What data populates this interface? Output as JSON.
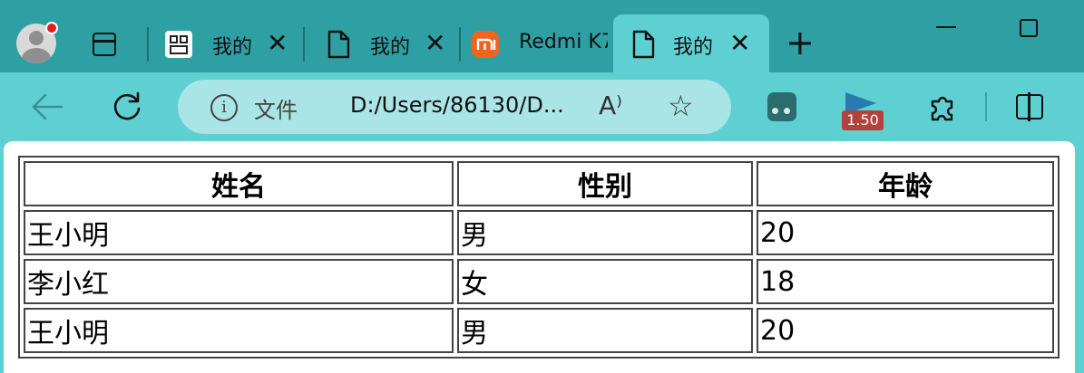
{
  "browser": {
    "tabs": [
      {
        "title": "我的",
        "favicon": "app-grid-icon",
        "active": false
      },
      {
        "title": "我的",
        "favicon": "file-icon",
        "active": false
      },
      {
        "title": "Redmi K7",
        "favicon": "mi-icon",
        "active": false
      },
      {
        "title": "我的",
        "favicon": "file-icon",
        "active": true
      }
    ],
    "close_glyph": "✕",
    "new_tab_glyph": "+",
    "address": {
      "info_glyph": "i",
      "scheme_label": "文件",
      "url": "D:/Users/86130/D...",
      "read_aloud_glyph": "A⁾",
      "favorite_glyph": "☆"
    },
    "extensions": {
      "player_badge": "1.50"
    },
    "colors": {
      "tabstrip": "#2ea0a3",
      "toolbar": "#5fd0d2",
      "addressbar": "#a9e4e6",
      "badge": "#b3423b",
      "mi_brand": "#f2641e"
    }
  },
  "table": {
    "headers": [
      "姓名",
      "性别",
      "年龄"
    ],
    "rows": [
      [
        "王小明",
        "男",
        "20"
      ],
      [
        "李小红",
        "女",
        "18"
      ],
      [
        "王小明",
        "男",
        "20"
      ]
    ]
  }
}
